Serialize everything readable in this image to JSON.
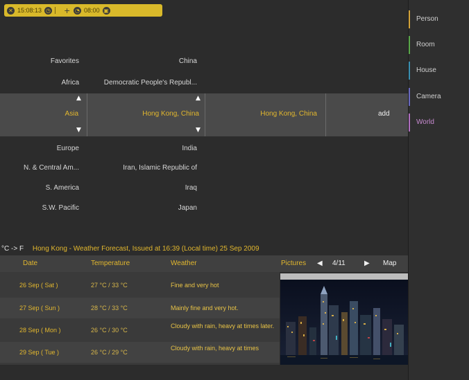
{
  "statusbar": {
    "time": "15:08:13",
    "alarm_time": "08:00",
    "icons": [
      "close-icon",
      "clock-icon",
      "plus-icon",
      "alarm-icon",
      "expand-icon"
    ]
  },
  "sidebar": {
    "items": [
      {
        "label": "Person",
        "color": "#d4a43a"
      },
      {
        "label": "Room",
        "color": "#5aa84a"
      },
      {
        "label": "House",
        "color": "#3a8fb0"
      },
      {
        "label": "Camera",
        "color": "#6a6ac0"
      },
      {
        "label": "World",
        "color": "#b070c0"
      }
    ],
    "active": "World"
  },
  "regions_above": [
    "Favorites",
    "Africa"
  ],
  "countries_above": [
    "China",
    "Democratic People's Republ..."
  ],
  "selected": {
    "region": "Asia",
    "country": "Hong Kong, China",
    "city": "Hong Kong, China",
    "add_label": "add"
  },
  "regions_below": [
    "Europe",
    "N. & Central Am...",
    "S. America",
    "S.W. Pacific"
  ],
  "countries_below": [
    "India",
    "Iran, Islamic Republic of",
    "Iraq",
    "Japan"
  ],
  "weather": {
    "unit_toggle": "°C -> F",
    "title": "Hong Kong - Weather Forecast, Issued at 16:39 (Local time) 25 Sep 2009",
    "headers": {
      "date": "Date",
      "temperature": "Temperature",
      "weather": "Weather"
    },
    "pictures_label": "Pictures",
    "picture_index": "4/11",
    "map_label": "Map",
    "rows": [
      {
        "date": "26 Sep ( Sat )",
        "temp": "27 °C  / 33 °C",
        "weather": "Fine and very hot"
      },
      {
        "date": "27 Sep ( Sun )",
        "temp": "28 °C  / 33 °C",
        "weather": "Mainly fine and very hot."
      },
      {
        "date": "28 Sep ( Mon )",
        "temp": "26 °C  / 30 °C",
        "weather": "Cloudy with rain, heavy at times later."
      },
      {
        "date": "29 Sep ( Tue )",
        "temp": "26 °C  / 29 °C",
        "weather": "Cloudy with rain, heavy at times"
      }
    ]
  }
}
